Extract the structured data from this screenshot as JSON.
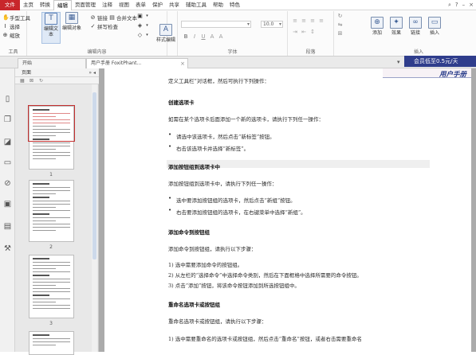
{
  "menu": {
    "file": "文件",
    "tabs": [
      "主页",
      "转换",
      "编辑",
      "页面管理",
      "注释",
      "视图",
      "表单",
      "保护",
      "共享",
      "辅助工具",
      "帮助",
      "特色"
    ],
    "active_index": 2,
    "right_icons": [
      "search-icon",
      "help-icon",
      "minimize-icon",
      "close-icon"
    ]
  },
  "ribbon": {
    "tools": {
      "items": [
        "手型工具",
        "选择",
        "缩放"
      ],
      "label": "工具"
    },
    "edit_content": {
      "big": [
        "编辑文本",
        "编辑对象"
      ],
      "small": [
        "链接",
        "合并文本",
        "拼写检查"
      ],
      "label": "编辑内容"
    },
    "style": {
      "big": "样式编辑"
    },
    "font": {
      "size_value": "10.0",
      "format_glyphs": [
        "B",
        "I",
        "U",
        "A",
        "A"
      ],
      "label": "字体"
    },
    "paragraph": {
      "label": "段落"
    },
    "insert": {
      "items": [
        "旋转",
        "插入",
        "分割",
        "页眉页脚"
      ],
      "big": [
        "添加",
        "效果",
        "链接",
        "插入"
      ],
      "label": "插入"
    }
  },
  "doc_tabs": [
    {
      "label": "开始",
      "active": false
    },
    {
      "label": "用户手册 FoxitPhant...",
      "active": true
    }
  ],
  "vip_banner": "会员低至0.5元/天",
  "thumbnails": {
    "header": "页面",
    "controls": [
      "»",
      "◂"
    ],
    "page_numbers": [
      "1",
      "2",
      "3"
    ]
  },
  "document": {
    "header_title": "用户手册",
    "lines": [
      {
        "text": "定义工具栏”对话框，然后可执行下列操作：",
        "kind": "text"
      },
      {
        "text": "创建选项卡",
        "kind": "heading"
      },
      {
        "text": "如需在某个选项卡后面添加一个新的选项卡，请执行下列任一操作：",
        "kind": "text"
      },
      {
        "text": "请选中该选项卡，然后点击“新标签”按钮。",
        "kind": "bullet"
      },
      {
        "text": "右击该选项卡并选择“新标签”。",
        "kind": "bullet"
      },
      {
        "text": "添加按钮组到选项卡中",
        "kind": "heading"
      },
      {
        "text": "添加按钮组到选项卡中，请执行下列任一操作：",
        "kind": "text"
      },
      {
        "text": "选中要添加按钮组的选项卡，然后点击“新组”按钮。",
        "kind": "bullet"
      },
      {
        "text": "右击要添加按钮组的选项卡，在右键菜单中选择“新组”。",
        "kind": "bullet"
      },
      {
        "text": "添加命令到按钮组",
        "kind": "heading"
      },
      {
        "text": "添加命令到按钮组，请执行以下步骤：",
        "kind": "text"
      },
      {
        "text": "1)  选中需要添加命令的按钮组。",
        "kind": "text"
      },
      {
        "text": "2)  从左栏的“选择命令”中选择命令类别，然后在下面框格中选择所需要的命令按钮。",
        "kind": "text"
      },
      {
        "text": "3)  点击“添加”按钮，将该命令按钮添加到所选按钮组中。",
        "kind": "text"
      },
      {
        "text": "重命名选项卡或按钮组",
        "kind": "heading"
      },
      {
        "text": "重命名选项卡或按钮组，请执行以下步骤：",
        "kind": "text"
      },
      {
        "text": "1)  选中需要重命名的选项卡或按钮组，然后点击“重命名”按钮，或者右击需要重命名",
        "kind": "text"
      }
    ]
  }
}
